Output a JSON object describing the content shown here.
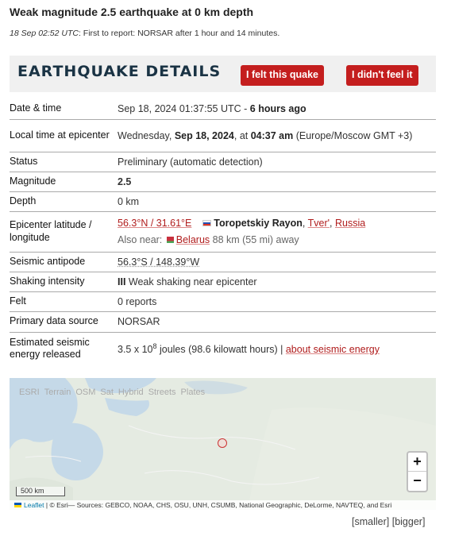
{
  "headline": "Weak magnitude 2.5 earthquake at 0 km depth",
  "report": {
    "time": "18 Sep 02:52 UTC",
    "text": ": First to report: NORSAR after 1 hour and 14 minutes."
  },
  "details": {
    "title": "EARTHQUAKE DETAILS",
    "felt_button": "I felt this quake",
    "not_felt_button": "I didn't feel it"
  },
  "rows": {
    "datetime": {
      "label": "Date & time",
      "value": "Sep 18, 2024 01:37:55 UTC - ",
      "ago": "6 hours ago"
    },
    "local": {
      "label": "Local time at epicenter",
      "prefix": "Wednesday, ",
      "date": "Sep 18, 2024",
      "mid": ", at ",
      "time": "04:37 am",
      "tz": " (Europe/Moscow GMT +3)"
    },
    "status": {
      "label": "Status",
      "value": "Preliminary (automatic detection)"
    },
    "magnitude": {
      "label": "Magnitude",
      "value": "2.5"
    },
    "depth": {
      "label": "Depth",
      "value": "0 km"
    },
    "epicenter": {
      "label": "Epicenter latitude / longitude",
      "coords": "56.3°N / 31.61°E",
      "district": "Toropetskiy Rayon",
      "region": "Tver'",
      "sep": ", ",
      "country": "Russia",
      "also_near_label": "Also near:",
      "also_near_country": "Belarus",
      "also_near_distance": " 88 km (55 mi) away"
    },
    "antipode": {
      "label": "Seismic antipode",
      "value": "56.3°S / 148.39°W"
    },
    "shaking": {
      "label": "Shaking intensity",
      "level": "III",
      "value": " Weak shaking near epicenter"
    },
    "felt": {
      "label": "Felt",
      "value": "0 reports"
    },
    "source": {
      "label": "Primary data source",
      "value": "NORSAR"
    },
    "energy": {
      "label": "Estimated seismic energy released",
      "base": "3.5 x 10",
      "exp": "8",
      "rest": " joules (98.6 kilowatt hours) | ",
      "link": "about seismic energy"
    }
  },
  "map": {
    "layers": [
      "ESRI",
      "Terrain",
      "OSM",
      "Sat",
      "Hybrid",
      "Streets",
      "Plates"
    ],
    "zoom_in": "+",
    "zoom_out": "−",
    "scale": "500 km",
    "attribution_leaflet": "Leaflet",
    "attribution_text": " | © Esri— Sources: GEBCO, NOAA, CHS, OSU, UNH, CSUMB, National Geographic, DeLorme, NAVTEQ, and Esri"
  },
  "size_links": {
    "smaller": "[smaller]",
    "bigger": "[bigger]"
  },
  "colors": {
    "accent_red": "#c41e1e",
    "title_navy": "#1a3344",
    "map_water": "#c5d9e8",
    "map_land": "#e5ebe2"
  }
}
